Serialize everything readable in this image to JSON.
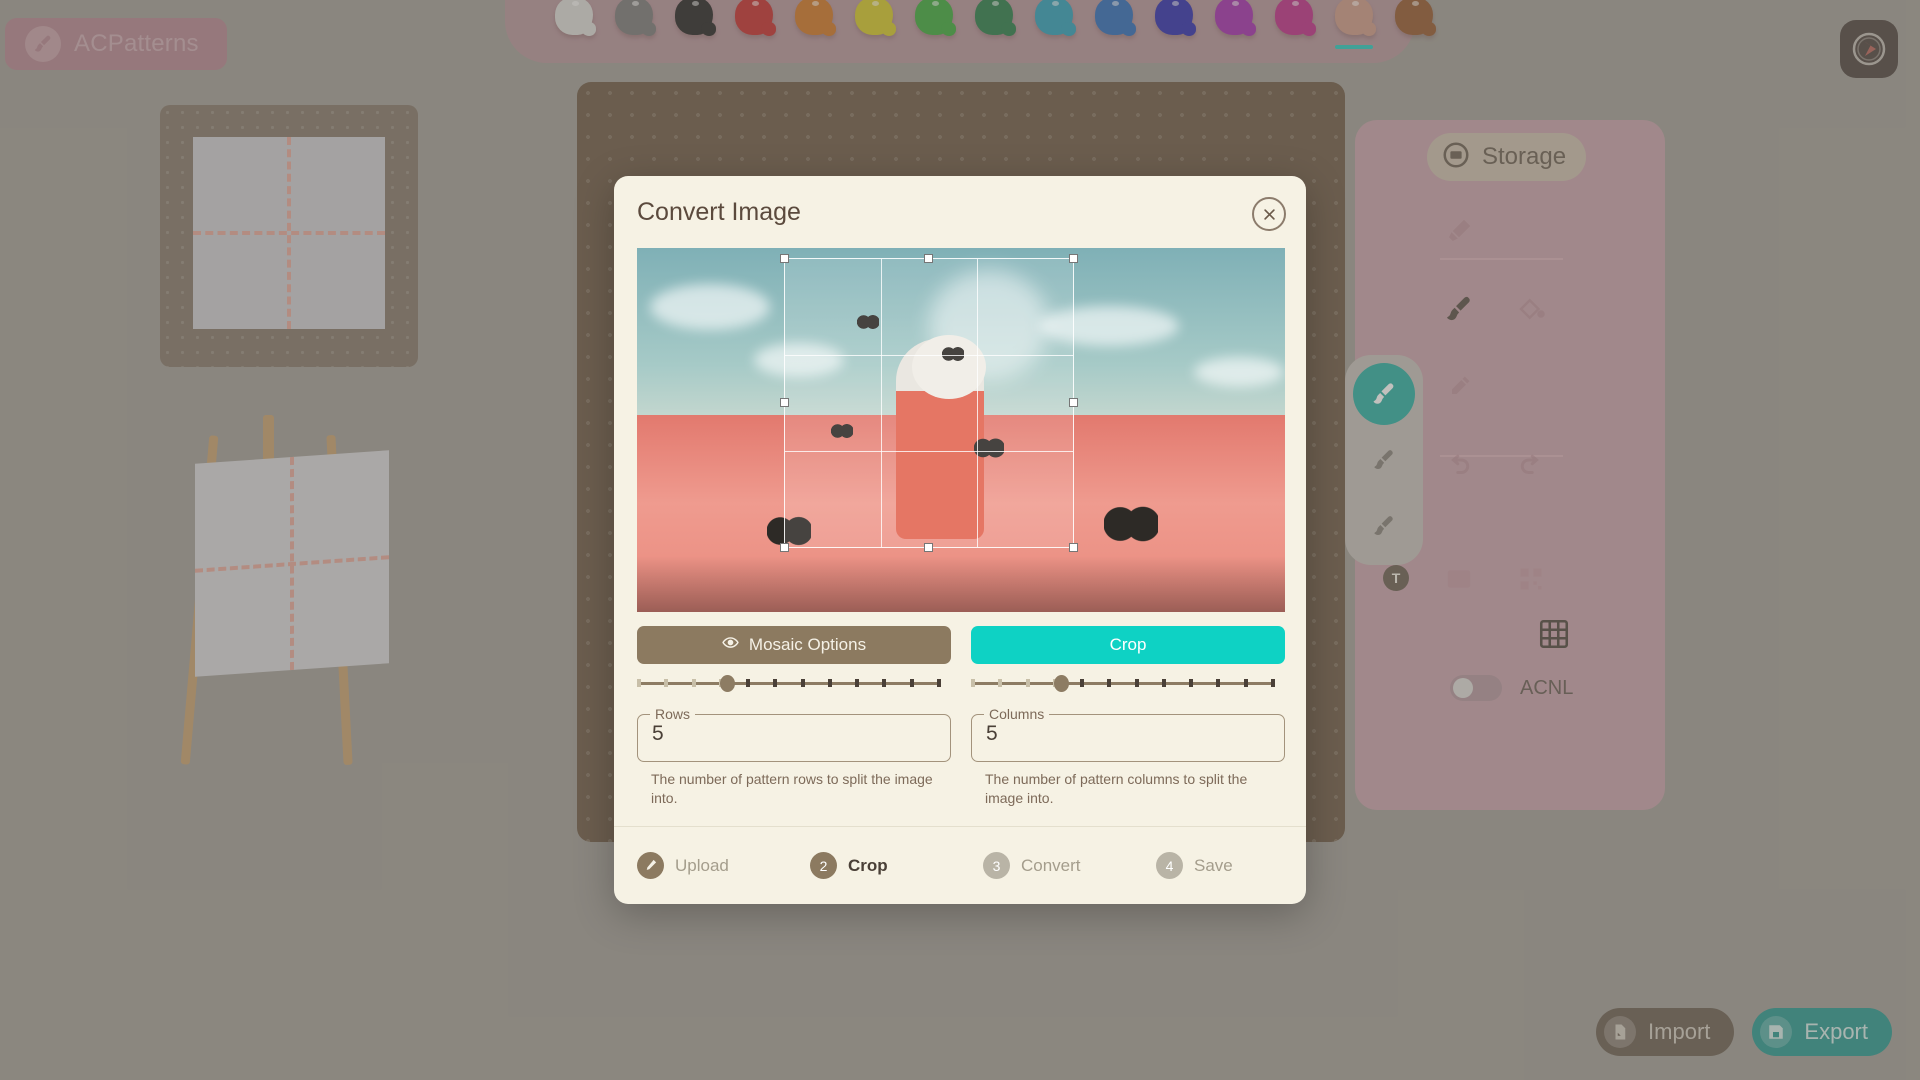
{
  "brand": {
    "name": "ACPatterns",
    "logo_icon": "paintbrush-circle-icon"
  },
  "app_icon": {
    "name": "acpatterns-app-icon"
  },
  "palette": {
    "selected_index": 13,
    "swatches": [
      {
        "name": "white",
        "color": "#d8d8d4"
      },
      {
        "name": "gray",
        "color": "#6e6e6e"
      },
      {
        "name": "black",
        "color": "#111111"
      },
      {
        "name": "red",
        "color": "#c01a1a"
      },
      {
        "name": "orange",
        "color": "#cd6a11"
      },
      {
        "name": "yellow",
        "color": "#cfc315"
      },
      {
        "name": "green",
        "color": "#2aa32a"
      },
      {
        "name": "dark-green",
        "color": "#14713a"
      },
      {
        "name": "cyan",
        "color": "#1a97b5"
      },
      {
        "name": "blue",
        "color": "#1b5fb5"
      },
      {
        "name": "navy",
        "color": "#1a1aa8"
      },
      {
        "name": "purple",
        "color": "#9c1ba8"
      },
      {
        "name": "magenta",
        "color": "#b81a7e"
      },
      {
        "name": "tan",
        "color": "#c9917c"
      },
      {
        "name": "brown",
        "color": "#8a4a1c"
      }
    ],
    "selected_underline_color": "#14c7bb"
  },
  "right_panel": {
    "storage_label": "Storage",
    "storage_icon": "storage-box-icon",
    "tools": [
      {
        "name": "marker-tool",
        "icon": "marker-icon",
        "active": false
      },
      {
        "name": "pen-tool",
        "icon": "pen-icon",
        "active": false
      },
      {
        "name": "brush-tool",
        "icon": "brush-icon",
        "active": true
      },
      {
        "name": "fill-tool",
        "icon": "paint-bucket-icon",
        "active": false
      },
      {
        "name": "eyedropper-tool",
        "icon": "eyedropper-icon",
        "active": false
      },
      {
        "name": "spacer-tool",
        "icon": "blank-icon",
        "active": false
      },
      {
        "name": "undo-action",
        "icon": "undo-arrow-icon",
        "active": false
      },
      {
        "name": "redo-action",
        "icon": "redo-arrow-icon",
        "active": false
      },
      {
        "name": "details-panel",
        "icon": "list-card-icon",
        "active": false
      },
      {
        "name": "qr-code",
        "icon": "qr-code-icon",
        "active": false
      },
      {
        "name": "grid-toggle",
        "icon": "grid-icon",
        "active": false
      }
    ],
    "brush_sizes": [
      {
        "name": "brush-size-small",
        "active": true
      },
      {
        "name": "brush-size-medium",
        "active": false
      },
      {
        "name": "brush-size-large",
        "active": false
      }
    ],
    "text_badge": "T",
    "acnl_toggle": {
      "label": "ACNL",
      "on": false
    }
  },
  "bottom_actions": {
    "import_label": "Import",
    "import_icon": "file-import-icon",
    "export_label": "Export",
    "export_icon": "floppy-save-icon"
  },
  "dialog": {
    "title": "Convert Image",
    "close_icon": "close-icon",
    "image": {
      "alt": "astronaut in a field of red flowers with butterflies"
    },
    "crop_selection": {
      "handles": 8,
      "grid_lines": 3
    },
    "buttons": {
      "mosaic_label": "Mosaic Options",
      "mosaic_icon": "eye-icon",
      "mosaic_color": "#8c7a60",
      "crop_label": "Crop",
      "crop_color": "#0ed2c4"
    },
    "sliders": {
      "rows": {
        "value": 5,
        "min": 1,
        "max": 12,
        "ticks": 12,
        "position_pct": 30
      },
      "columns": {
        "value": 5,
        "min": 1,
        "max": 12,
        "ticks": 12,
        "position_pct": 30
      }
    },
    "fields": {
      "rows": {
        "label": "Rows",
        "value": "5",
        "helper": "The number of pattern rows to split the image into."
      },
      "columns": {
        "label": "Columns",
        "value": "5",
        "helper": "The number of pattern columns to split the image into."
      }
    },
    "steps": [
      {
        "num": "1",
        "label": "Upload",
        "state": "done",
        "icon": "pencil-icon"
      },
      {
        "num": "2",
        "label": "Crop",
        "state": "active",
        "icon": ""
      },
      {
        "num": "3",
        "label": "Convert",
        "state": "idle",
        "icon": ""
      },
      {
        "num": "4",
        "label": "Save",
        "state": "idle",
        "icon": ""
      }
    ]
  }
}
